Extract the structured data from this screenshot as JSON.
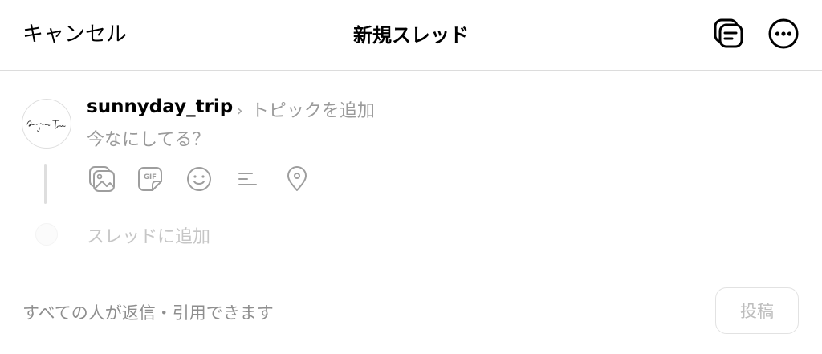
{
  "header": {
    "cancel_label": "キャンセル",
    "title": "新規スレッド",
    "icons": [
      "drafts-icon",
      "more-options-icon"
    ]
  },
  "post": {
    "username": "sunnyday_trip",
    "topic_chevron": "›",
    "topic_placeholder": "トピックを追加",
    "compose_placeholder": "今なにしてる？",
    "toolbar_icons": [
      "gallery-icon",
      "gif-icon",
      "emoji-icon",
      "poll-icon",
      "location-icon"
    ]
  },
  "add_thread": {
    "label": "スレッドに追加"
  },
  "footer": {
    "reply_setting": "すべての人が返信・引用できます",
    "post_label": "投稿"
  },
  "colors": {
    "text_primary": "#000000",
    "placeholder": "#9a9a9a",
    "icon_gray": "#9e9e9e",
    "disabled": "#bdbdbd",
    "divider": "#dcdcdc"
  }
}
